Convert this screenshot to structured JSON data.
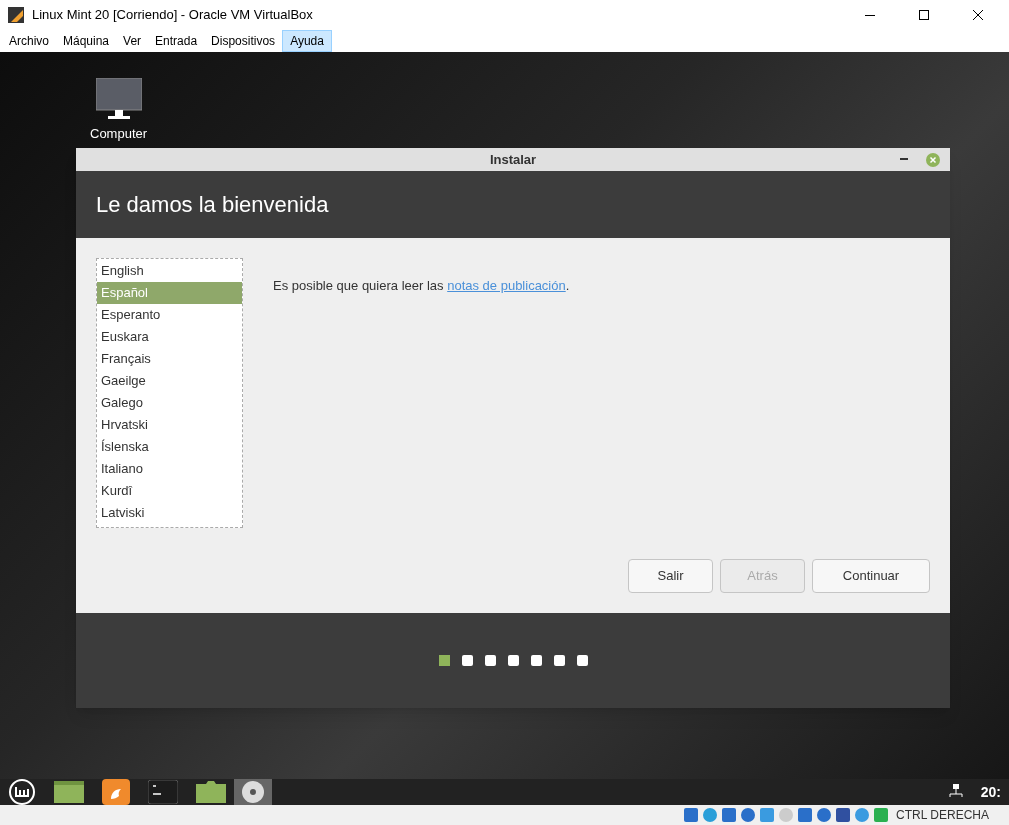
{
  "window": {
    "title": "Linux Mint 20 [Corriendo] - Oracle VM VirtualBox"
  },
  "menu": [
    {
      "label": "Archivo",
      "selected": false
    },
    {
      "label": "Máquina",
      "selected": false
    },
    {
      "label": "Ver",
      "selected": false
    },
    {
      "label": "Entrada",
      "selected": false
    },
    {
      "label": "Dispositivos",
      "selected": false
    },
    {
      "label": "Ayuda",
      "selected": true
    }
  ],
  "desktop_icons": [
    {
      "label": "Computer"
    }
  ],
  "installer": {
    "title": "Instalar",
    "heading": "Le damos la bienvenida",
    "languages": [
      {
        "label": "English",
        "selected": false
      },
      {
        "label": "Español",
        "selected": true
      },
      {
        "label": "Esperanto",
        "selected": false
      },
      {
        "label": "Euskara",
        "selected": false
      },
      {
        "label": "Français",
        "selected": false
      },
      {
        "label": "Gaeilge",
        "selected": false
      },
      {
        "label": "Galego",
        "selected": false
      },
      {
        "label": "Hrvatski",
        "selected": false
      },
      {
        "label": "Íslenska",
        "selected": false
      },
      {
        "label": "Italiano",
        "selected": false
      },
      {
        "label": "Kurdî",
        "selected": false
      },
      {
        "label": "Latviski",
        "selected": false
      }
    ],
    "message": "Es posible que quiera leer las",
    "link": "notas de publicación",
    "message_end": ".",
    "buttons": [
      {
        "label": "Salir",
        "disabled": false
      },
      {
        "label": "Atrás",
        "disabled": true
      },
      {
        "label": "Continuar",
        "disabled": false
      }
    ],
    "steps": [
      {
        "selected": true
      },
      {
        "selected": false
      },
      {
        "selected": false
      },
      {
        "selected": false
      },
      {
        "selected": false
      },
      {
        "selected": false
      },
      {
        "selected": false
      }
    ]
  },
  "taskbar": {
    "clock": "20:"
  },
  "status_bar": {
    "host_key": "CTRL DERECHA"
  }
}
